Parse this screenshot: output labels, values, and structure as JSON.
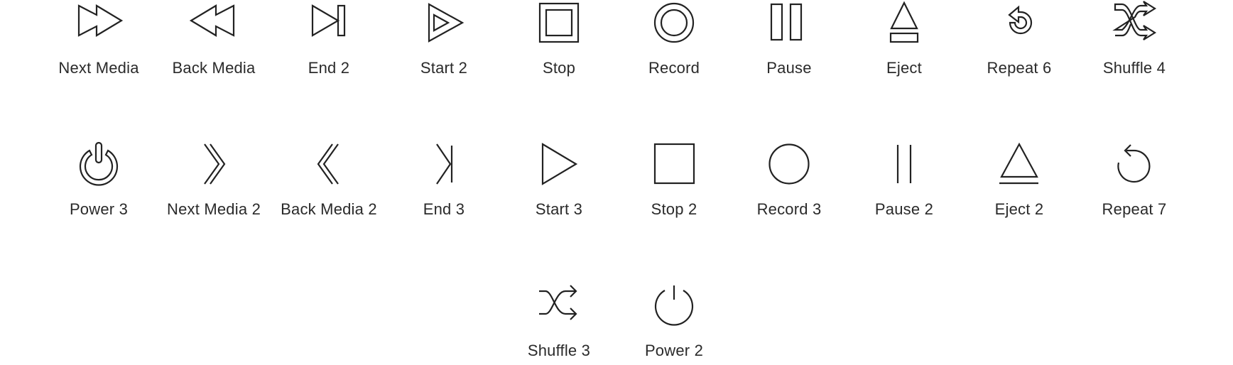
{
  "icons": [
    {
      "label": "Next Media",
      "icon": "next-media-icon"
    },
    {
      "label": "Back Media",
      "icon": "back-media-icon"
    },
    {
      "label": "End 2",
      "icon": "end-icon"
    },
    {
      "label": "Start 2",
      "icon": "start-icon"
    },
    {
      "label": "Stop",
      "icon": "stop-icon"
    },
    {
      "label": "Record",
      "icon": "record-icon"
    },
    {
      "label": "Pause",
      "icon": "pause-icon"
    },
    {
      "label": "Eject",
      "icon": "eject-icon"
    },
    {
      "label": "Repeat 6",
      "icon": "repeat-icon"
    },
    {
      "label": "Shuffle 4",
      "icon": "shuffle-icon"
    },
    {
      "label": "Power 3",
      "icon": "power-icon"
    },
    {
      "label": "Next Media 2",
      "icon": "next-media-icon"
    },
    {
      "label": "Back Media 2",
      "icon": "back-media-icon"
    },
    {
      "label": "End 3",
      "icon": "end-icon"
    },
    {
      "label": "Start 3",
      "icon": "start-icon"
    },
    {
      "label": "Stop 2",
      "icon": "stop-icon"
    },
    {
      "label": "Record 3",
      "icon": "record-icon"
    },
    {
      "label": "Pause 2",
      "icon": "pause-icon"
    },
    {
      "label": "Eject 2",
      "icon": "eject-icon"
    },
    {
      "label": "Repeat 7",
      "icon": "repeat-icon"
    },
    {
      "label": "Shuffle 3",
      "icon": "shuffle-icon"
    },
    {
      "label": "Power 2",
      "icon": "power-icon"
    }
  ],
  "colors": {
    "icon_stroke": "#222222",
    "background": "#ffffff"
  }
}
